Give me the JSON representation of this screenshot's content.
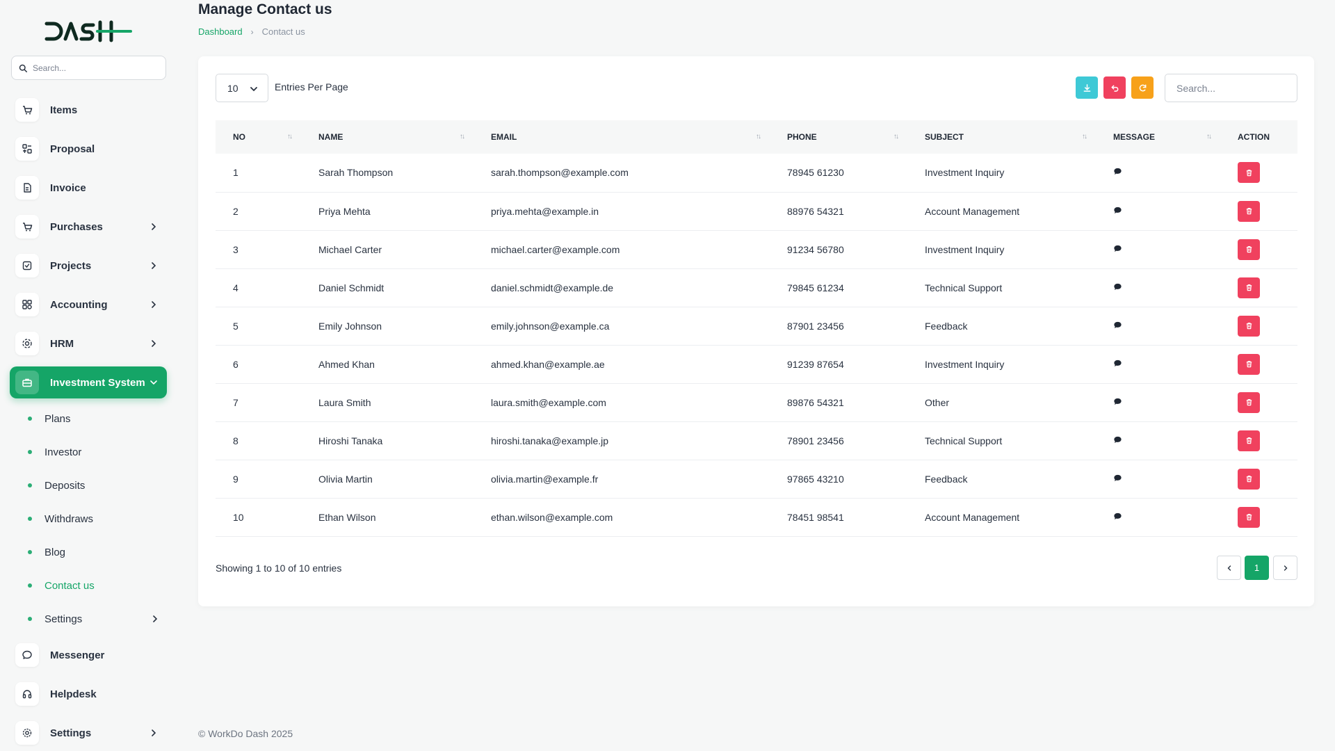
{
  "app": {
    "logo_text": "DASH"
  },
  "sidebar": {
    "search_placeholder": "Search...",
    "items": [
      {
        "label": "Items",
        "icon": "cart-icon",
        "has_children": false
      },
      {
        "label": "Proposal",
        "icon": "proposal-icon",
        "has_children": false
      },
      {
        "label": "Invoice",
        "icon": "invoice-icon",
        "has_children": false
      },
      {
        "label": "Purchases",
        "icon": "cart-icon",
        "has_children": true
      },
      {
        "label": "Projects",
        "icon": "checklist-icon",
        "has_children": true
      },
      {
        "label": "Accounting",
        "icon": "grid-icon",
        "has_children": true
      },
      {
        "label": "HRM",
        "icon": "hrm-icon",
        "has_children": true
      },
      {
        "label": "Investment System",
        "icon": "briefcase-icon",
        "has_children": true,
        "active": true
      }
    ],
    "sub_items": [
      {
        "label": "Plans"
      },
      {
        "label": "Investor"
      },
      {
        "label": "Deposits"
      },
      {
        "label": "Withdraws"
      },
      {
        "label": "Blog"
      },
      {
        "label": "Contact us",
        "current": true
      },
      {
        "label": "Settings",
        "has_children": true
      }
    ],
    "bottom_items": [
      {
        "label": "Messenger",
        "icon": "chat-icon",
        "has_children": false
      },
      {
        "label": "Helpdesk",
        "icon": "headset-icon",
        "has_children": false
      },
      {
        "label": "Settings",
        "icon": "gear-icon",
        "has_children": true
      }
    ]
  },
  "header": {
    "title": "Manage Contact us",
    "breadcrumb": {
      "home": "Dashboard",
      "current": "Contact us"
    }
  },
  "table_controls": {
    "per_page_value": "10",
    "per_page_label": "Entries Per Page",
    "search_placeholder": "Search...",
    "colors": {
      "export": "#3ec9d6",
      "reset": "#f0415e",
      "refresh": "#f7a11a"
    }
  },
  "table": {
    "columns": [
      "NO",
      "NAME",
      "EMAIL",
      "PHONE",
      "SUBJECT",
      "MESSAGE",
      "ACTION"
    ],
    "rows": [
      {
        "no": "1",
        "name": "Sarah Thompson",
        "email": "sarah.thompson@example.com",
        "phone": "78945 61230",
        "subject": "Investment Inquiry"
      },
      {
        "no": "2",
        "name": "Priya Mehta",
        "email": "priya.mehta@example.in",
        "phone": "88976 54321",
        "subject": "Account Management"
      },
      {
        "no": "3",
        "name": "Michael Carter",
        "email": "michael.carter@example.com",
        "phone": "91234 56780",
        "subject": "Investment Inquiry"
      },
      {
        "no": "4",
        "name": "Daniel Schmidt",
        "email": "daniel.schmidt@example.de",
        "phone": "79845 61234",
        "subject": "Technical Support"
      },
      {
        "no": "5",
        "name": "Emily Johnson",
        "email": "emily.johnson@example.ca",
        "phone": "87901 23456",
        "subject": "Feedback"
      },
      {
        "no": "6",
        "name": "Ahmed Khan",
        "email": "ahmed.khan@example.ae",
        "phone": "91239 87654",
        "subject": "Investment Inquiry"
      },
      {
        "no": "7",
        "name": "Laura Smith",
        "email": "laura.smith@example.com",
        "phone": "89876 54321",
        "subject": "Other"
      },
      {
        "no": "8",
        "name": "Hiroshi Tanaka",
        "email": "hiroshi.tanaka@example.jp",
        "phone": "78901 23456",
        "subject": "Technical Support"
      },
      {
        "no": "9",
        "name": "Olivia Martin",
        "email": "olivia.martin@example.fr",
        "phone": "97865 43210",
        "subject": "Feedback"
      },
      {
        "no": "10",
        "name": "Ethan Wilson",
        "email": "ethan.wilson@example.com",
        "phone": "78451 98541",
        "subject": "Account Management"
      }
    ]
  },
  "pagination": {
    "showing_text": "Showing 1 to 10 of 10 entries",
    "current_page": "1"
  },
  "footer": {
    "text": "© WorkDo Dash 2025"
  },
  "theme": {
    "primary": "#15a567",
    "danger": "#f0415e"
  }
}
